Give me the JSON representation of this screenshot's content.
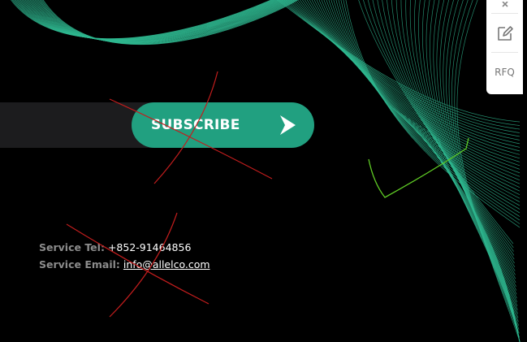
{
  "newsletter": {
    "input_placeholder": "",
    "subscribe_label": "SUBSCRIBE"
  },
  "contact": {
    "tel_label": "Service Tel:",
    "tel_value": "+852-91464856",
    "email_label": "Service Email:",
    "email_value": "info@allelco.com"
  },
  "side_panel": {
    "items": [
      {
        "icon": "close-icon"
      },
      {
        "icon": "edit-note-icon"
      },
      {
        "label": "RFQ"
      }
    ]
  },
  "colors": {
    "accent": "#21a080",
    "wave": "#2fb890",
    "background": "#000000"
  }
}
